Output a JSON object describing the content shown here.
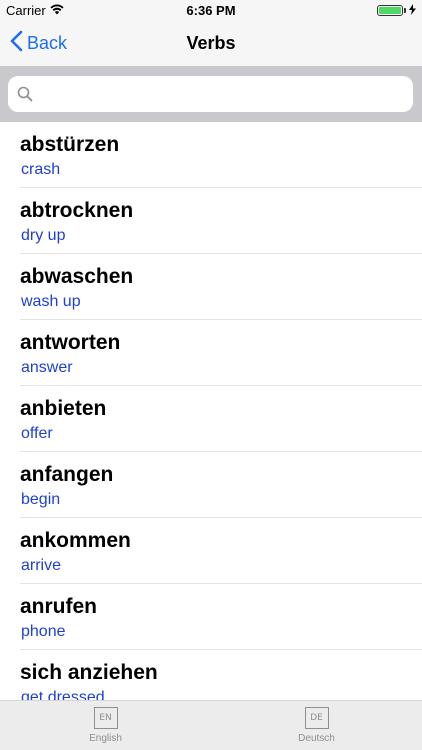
{
  "status_bar": {
    "carrier": "Carrier",
    "time": "6:36 PM",
    "battery_level": 1.0
  },
  "nav": {
    "back_label": "Back",
    "title": "Verbs"
  },
  "search": {
    "placeholder": "",
    "value": ""
  },
  "verbs": [
    {
      "word": "abstürzen",
      "translation": "crash"
    },
    {
      "word": "abtrocknen",
      "translation": "dry up"
    },
    {
      "word": "abwaschen",
      "translation": "wash up"
    },
    {
      "word": "antworten",
      "translation": "answer"
    },
    {
      "word": "anbieten",
      "translation": "offer"
    },
    {
      "word": "anfangen",
      "translation": "begin"
    },
    {
      "word": "ankommen",
      "translation": "arrive"
    },
    {
      "word": "anrufen",
      "translation": "phone"
    },
    {
      "word": "sich anziehen",
      "translation": "get dressed"
    }
  ],
  "tabs": [
    {
      "icon_text": "EN",
      "label": "English"
    },
    {
      "icon_text": "DE",
      "label": "Deutsch"
    }
  ],
  "colors": {
    "accent": "#1a6ef3",
    "translation": "#1f3fd4",
    "battery": "#4cd964"
  }
}
